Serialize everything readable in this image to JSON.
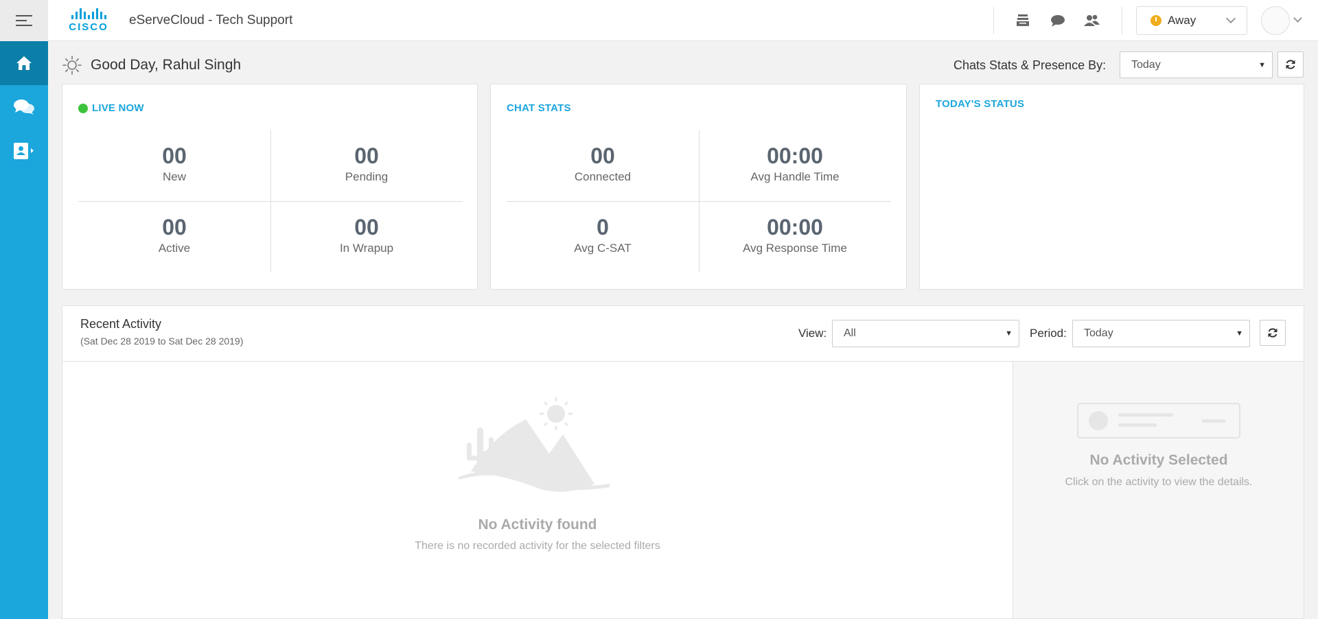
{
  "header": {
    "logo_text": "CISCO",
    "app_title": "eServeCloud - Tech Support",
    "icons": [
      "queue-icon",
      "chat-icon",
      "contacts-icon"
    ],
    "status": "Away",
    "status_color": "#f0ad1e"
  },
  "sidebar": {
    "items": [
      {
        "name": "home",
        "icon": "home-icon",
        "active": true
      },
      {
        "name": "chats",
        "icon": "chat-bubbles-icon",
        "active": false
      },
      {
        "name": "contacts",
        "icon": "contact-book-icon",
        "active": false
      }
    ],
    "color": "#1ba6dc"
  },
  "greeting": "Good Day, Rahul Singh",
  "stats_by": {
    "label": "Chats Stats & Presence By:",
    "value": "Today"
  },
  "live_now": {
    "title": "LIVE NOW",
    "cells": [
      {
        "value": "00",
        "label": "New"
      },
      {
        "value": "00",
        "label": "Pending"
      },
      {
        "value": "00",
        "label": "Active"
      },
      {
        "value": "00",
        "label": "In Wrapup"
      }
    ]
  },
  "chat_stats": {
    "title": "CHAT STATS",
    "cells": [
      {
        "value": "00",
        "label": "Connected"
      },
      {
        "value": "00:00",
        "label": "Avg Handle Time"
      },
      {
        "value": "0",
        "label": "Avg C-SAT"
      },
      {
        "value": "00:00",
        "label": "Avg Response Time"
      }
    ]
  },
  "todays_status": {
    "title": "TODAY'S STATUS"
  },
  "recent_activity": {
    "title": "Recent Activity",
    "range": "(Sat Dec 28 2019 to Sat Dec 28 2019)",
    "view_label": "View:",
    "view_value": "All",
    "period_label": "Period:",
    "period_value": "Today",
    "empty_title": "No Activity found",
    "empty_sub": "There is no recorded activity for the selected filters",
    "detail_title": "No Activity Selected",
    "detail_sub": "Click on the activity to view the details."
  }
}
